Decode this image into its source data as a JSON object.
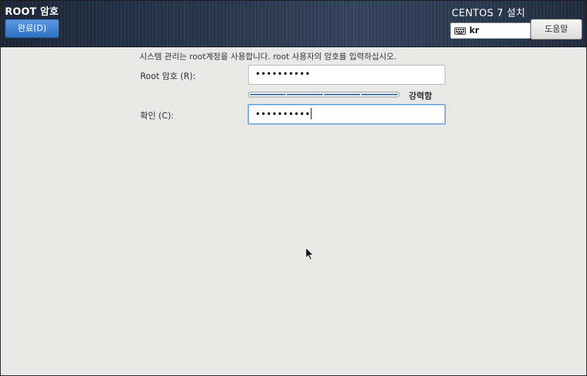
{
  "header": {
    "spoke_title": "ROOT 암호",
    "done_label": "완료(D)",
    "install_title": "CENTOS 7 설치",
    "keyboard_layout": "kr",
    "help_label": "도움말"
  },
  "form": {
    "intro": "시스템 관리는 root계정을 사용합니다. root 사용자의 암호를 입력하십시오.",
    "root_password_label": "Root 암호 (R):",
    "root_password_value": "••••••••••",
    "confirm_label": "확인 (C):",
    "confirm_value": "••••••••••",
    "strength_label": "강력함",
    "strength_fraction": 1.0
  },
  "colors": {
    "header_dark": "#1a2536",
    "accent_blue": "#2e6fc2",
    "strength_fill": "#3f74b3",
    "focus_border": "#4a90d9",
    "background": "#e8e8e7"
  }
}
